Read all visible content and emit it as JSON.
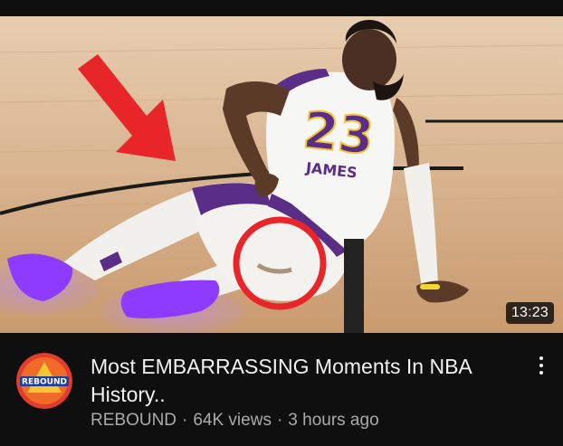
{
  "video": {
    "duration": "13:23",
    "title": "Most EMBARRASSING Moments In NBA History..",
    "channel": "REBOUND",
    "views": "64K views",
    "age": "3 hours ago",
    "separator": "·"
  },
  "thumbnail": {
    "jersey_number": "23",
    "jersey_name": "JAMES",
    "icons": {
      "arrow": "red-arrow-icon",
      "highlight": "red-circle-icon"
    }
  },
  "channel_avatar": {
    "logo_text": "REBOUND"
  },
  "colors": {
    "background": "#0f0f0f",
    "title_text": "#f1f1f1",
    "meta_text": "#aaaaaa",
    "arrow_red": "#e8262a",
    "jersey_purple": "#5a2d86",
    "shoe_purple": "#8f3bff",
    "floor": "#d9b48e"
  }
}
